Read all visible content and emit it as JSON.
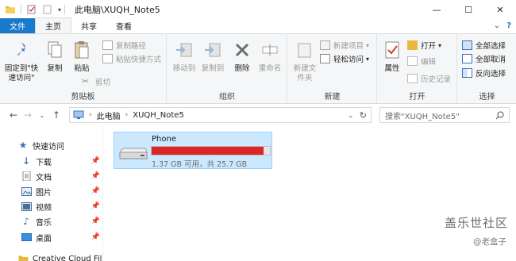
{
  "window": {
    "title": "此电脑\\XUQH_Note5",
    "minimize": "—",
    "maximize": "☐",
    "close": "✕"
  },
  "ribbon_tabs": [
    "文件",
    "主页",
    "共享",
    "查看"
  ],
  "ribbon": {
    "clipboard": {
      "label": "剪贴板",
      "pin_quick_access": "固定到\"快速访问\"",
      "copy": "复制",
      "paste": "粘贴",
      "copy_path": "复制路径",
      "paste_shortcut": "粘贴快捷方式",
      "cut": "剪切"
    },
    "organize": {
      "label": "组织",
      "move_to": "移动到",
      "copy_to": "复制到",
      "delete": "删除",
      "rename": "重命名"
    },
    "new": {
      "label": "新建",
      "new_folder": "新建文件夹",
      "new_item": "新建项目",
      "easy_access": "轻松访问"
    },
    "open": {
      "label": "打开",
      "properties": "属性",
      "open": "打开",
      "edit": "编辑",
      "history": "历史记录"
    },
    "select": {
      "label": "选择",
      "select_all": "全部选择",
      "select_none": "全部取消",
      "invert": "反向选择"
    }
  },
  "address": {
    "crumbs": [
      "此电脑",
      "XUQH_Note5"
    ],
    "search_placeholder": "搜索\"XUQH_Note5\""
  },
  "nav_pane": {
    "items": [
      {
        "label": "快速访问",
        "icon": "star-icon",
        "pinned": false
      },
      {
        "label": "下载",
        "icon": "download-icon",
        "pinned": true
      },
      {
        "label": "文档",
        "icon": "document-icon",
        "pinned": true
      },
      {
        "label": "图片",
        "icon": "picture-icon",
        "pinned": true
      },
      {
        "label": "视频",
        "icon": "video-icon",
        "pinned": true
      },
      {
        "label": "音乐",
        "icon": "music-icon",
        "pinned": true
      },
      {
        "label": "桌面",
        "icon": "desktop-icon",
        "pinned": true
      },
      {
        "label": "Creative Cloud Files",
        "icon": "folder-icon",
        "pinned": false
      }
    ]
  },
  "drive": {
    "name": "Phone",
    "info": "1.37 GB 可用，共 25.7 GB",
    "used_fraction": 0.947,
    "bar_color": "#da2626"
  },
  "watermark": {
    "line1": "盖乐世社区",
    "line2": "@老盒子"
  }
}
